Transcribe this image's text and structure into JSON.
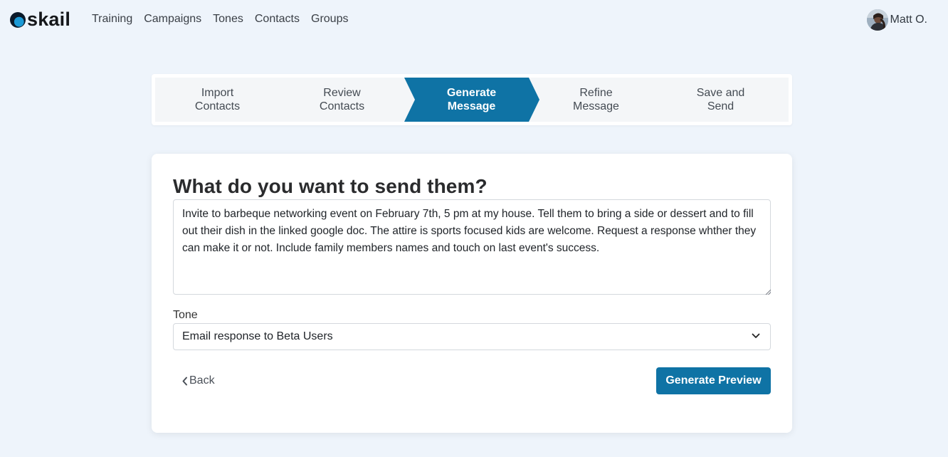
{
  "brand": {
    "name": "skail"
  },
  "nav": {
    "links": [
      "Training",
      "Campaigns",
      "Tones",
      "Contacts",
      "Groups"
    ]
  },
  "user": {
    "name": "Matt O."
  },
  "stepper": {
    "steps": [
      {
        "label": "Import Contacts",
        "active": false
      },
      {
        "label": "Review Contacts",
        "active": false
      },
      {
        "label": "Generate Message",
        "active": true
      },
      {
        "label": "Refine Message",
        "active": false
      },
      {
        "label": "Save and Send",
        "active": false
      }
    ],
    "active_color": "#0f73a5"
  },
  "form": {
    "heading": "What do you want to send them?",
    "message": "Invite to barbeque networking event on February 7th, 5 pm at my house. Tell them to bring a side or dessert and to fill out their dish in the linked google doc. The attire is sports focused kids are welcome. Request a response whther they can make it or not. Include family members names and touch on last event's success.",
    "tone_label": "Tone",
    "tone_value": "Email response to Beta Users",
    "back_label": "Back",
    "generate_label": "Generate Preview"
  },
  "colors": {
    "accent": "#0f73a5",
    "background": "#eef4fb"
  },
  "icons": {
    "dropdown": "chevron-down-icon",
    "back": "chevron-left-icon"
  }
}
